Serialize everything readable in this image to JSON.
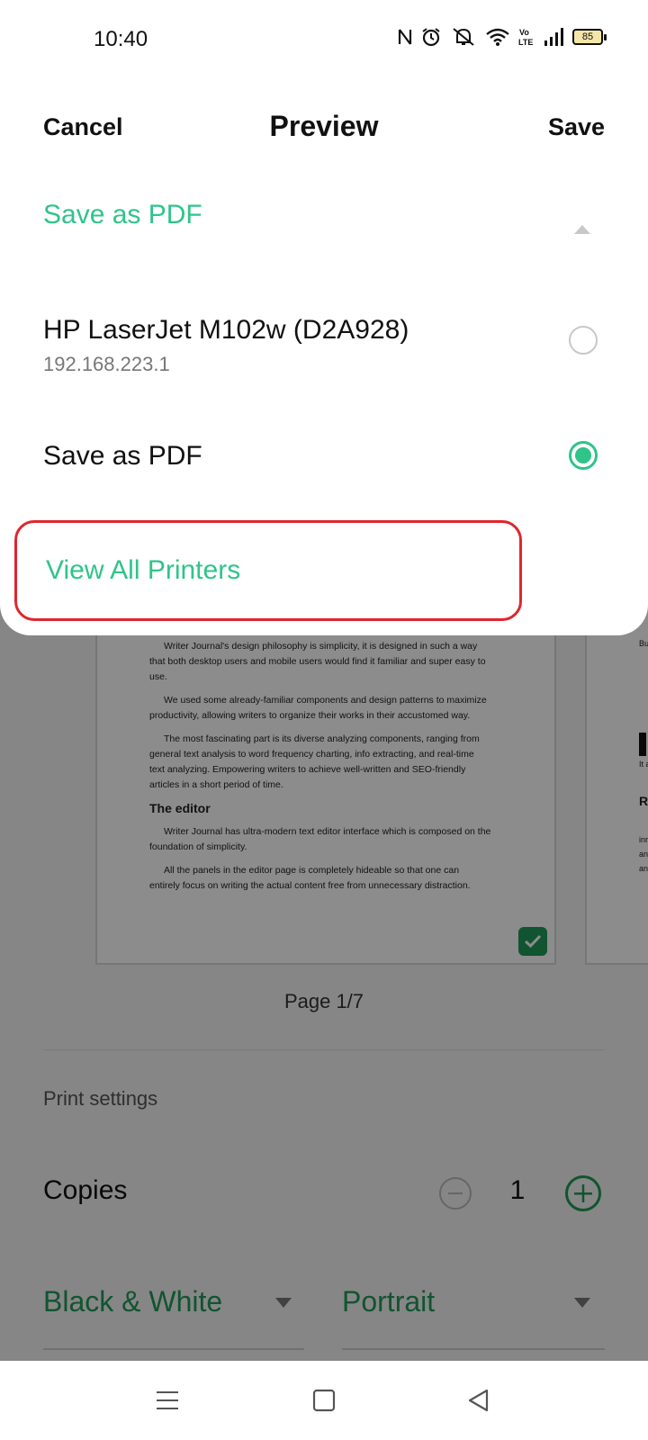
{
  "status_bar": {
    "time": "10:40",
    "icons": [
      "nfc-icon",
      "alarm-icon",
      "mute-icon",
      "wifi-icon",
      "volte-icon",
      "signal-icon"
    ],
    "battery": "85"
  },
  "header": {
    "cancel_label": "Cancel",
    "title": "Preview",
    "save_label": "Save"
  },
  "printer_select": {
    "selected": "Save as PDF",
    "options": [
      {
        "name": "HP LaserJet M102w (D2A928)",
        "sub": "192.168.223.1",
        "selected": false
      },
      {
        "name": "Save as PDF",
        "sub": "",
        "selected": true
      }
    ],
    "view_all_label": "View All Printers"
  },
  "preview": {
    "paragraphs": [
      "Writer Journal's design philosophy is simplicity, it is designed in such a way that both desktop users and mobile users would find it familiar and super easy to use.",
      "We used some already-familiar components and design patterns to maximize productivity, allowing writers to organize their works in their accustomed way.",
      "The most fascinating part is its diverse analyzing components, ranging from general text analysis to word frequency charting, info extracting, and real-time text analyzing. Empowering writers to achieve well-written and SEO-friendly articles in a short period of time."
    ],
    "heading": "The editor",
    "paragraphs2": [
      "Writer Journal has ultra-modern text editor interface which is composed on the foundation of simplicity.",
      "All the panels in the editor page is completely hideable so that one can entirely focus on writing the actual content free from unnecessary distraction."
    ],
    "page2_fragments": [
      "Bu",
      "It a",
      "R",
      "inr",
      "an",
      "an"
    ],
    "page_indicator": "Page 1/7"
  },
  "settings": {
    "section_title": "Print settings",
    "copies_label": "Copies",
    "copies_value": "1",
    "color_mode": "Black & White",
    "orientation": "Portrait"
  },
  "colors": {
    "accent": "#2fc48a",
    "accent_dark": "#1f9a5a",
    "highlight": "#e0262e"
  }
}
